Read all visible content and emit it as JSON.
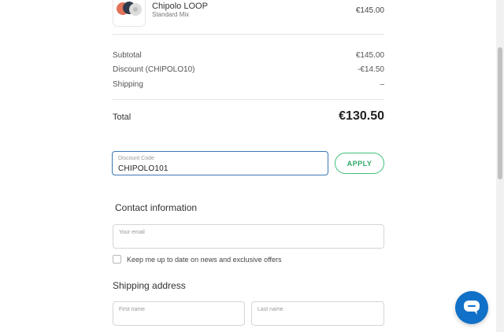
{
  "product": {
    "name": "Chipolo LOOP",
    "variant": "Standard Mix",
    "price": "€145.00",
    "image_icon": "chipolo-loop-trackers-image"
  },
  "summary": {
    "subtotal_label": "Subtotal",
    "subtotal_value": "€145.00",
    "discount_label": "Discount (CHIPOLO10)",
    "discount_value": "-€14.50",
    "shipping_label": "Shipping",
    "shipping_value": "–",
    "total_label": "Total",
    "total_value": "€130.50"
  },
  "discount": {
    "label": "Discount Code",
    "value": "CHIPOLO101",
    "apply_label": "APPLY"
  },
  "contact": {
    "title": "Contact information",
    "email_placeholder": "Your email",
    "newsletter_label": "Keep me up to date on news and exclusive offers",
    "newsletter_checked": false
  },
  "shipping": {
    "title": "Shipping address",
    "first_name_placeholder": "First name",
    "last_name_placeholder": "Last name"
  },
  "chat": {
    "icon": "chat-bubble-icon"
  },
  "colors": {
    "accent_green": "#3fbf7a",
    "focus_blue": "#3a78b5",
    "chat_blue": "#1170c7"
  }
}
